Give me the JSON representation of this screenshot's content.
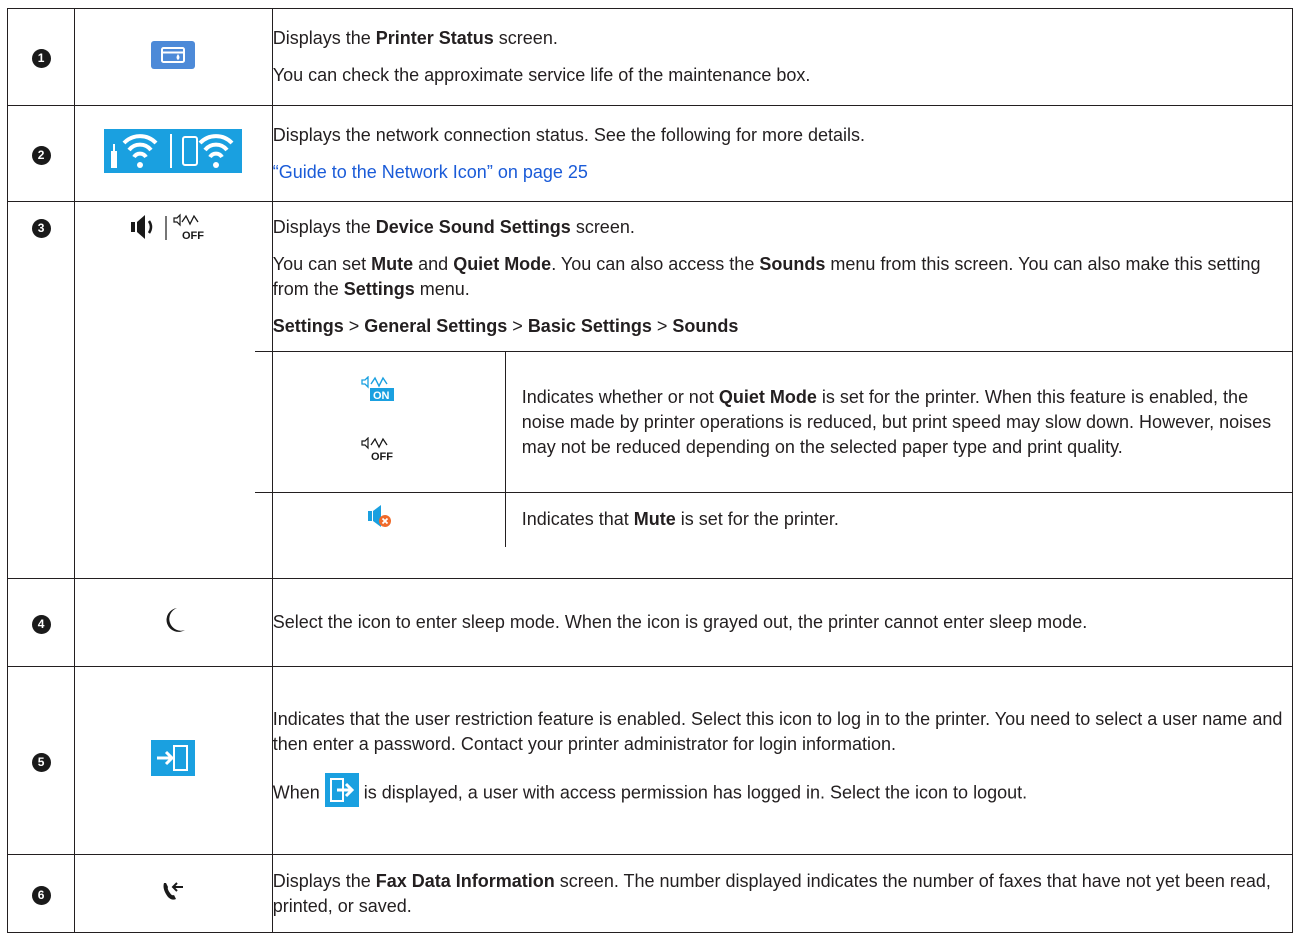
{
  "rows": [
    {
      "num": "1",
      "icon": "printer-status-icon",
      "lines": [
        [
          "Displays the ",
          "Printer Status",
          " screen."
        ],
        "You can check the approximate service life of the maintenance box."
      ]
    },
    {
      "num": "2",
      "icon": "network-status-icons",
      "text": "Displays the network connection status. See the following for more details.",
      "link": "“Guide to the Network Icon” on page 25"
    },
    {
      "num": "3",
      "icon": "sound-icons",
      "p1": {
        "a": "Displays the ",
        "b": "Device Sound Settings",
        "c": " screen."
      },
      "p2": {
        "t1": "You can set ",
        "b1": "Mute",
        "t2": " and ",
        "b2": "Quiet Mode",
        "t3": ". You can also access the ",
        "b3": "Sounds",
        "t4": " menu from this screen. You can also make this setting from the ",
        "b4": "Settings",
        "t5": " menu."
      },
      "path": [
        "Settings",
        "General Settings",
        "Basic Settings",
        "Sounds"
      ],
      "path_sep": " > ",
      "sub": [
        {
          "icon_top": "quiet-mode-on-icon",
          "icon_bottom": "quiet-mode-off-icon",
          "t1": "Indicates whether or not ",
          "b1": "Quiet Mode",
          "t2": " is set for the printer. When this feature is enabled, the noise made by printer operations is reduced, but print speed may slow down. However, noises may not be reduced depending on the selected paper type and print quality."
        },
        {
          "icon": "mute-icon",
          "t1": "Indicates that ",
          "b1": "Mute",
          "t2": " is set for the printer."
        }
      ]
    },
    {
      "num": "4",
      "icon": "sleep-moon-icon",
      "text": "Select the icon to enter sleep mode. When the icon is grayed out, the printer cannot enter sleep mode."
    },
    {
      "num": "5",
      "icon": "login-icon",
      "text": "Indicates that the user restriction feature is enabled. Select this icon to log in to the printer. You need to select a user name and then enter a password. Contact your printer administrator for login information.",
      "p2_a": "When ",
      "p2_icon": "logout-icon",
      "p2_b": " is displayed, a user with access permission has logged in. Select the icon to logout."
    },
    {
      "num": "6",
      "icon": "fax-data-icon",
      "t1": "Displays the ",
      "b1": "Fax Data Information",
      "t2": " screen. The number displayed indicates the number of faxes that have not yet been read, printed, or saved."
    }
  ],
  "icon_texts": {
    "on": "ON",
    "off": "OFF"
  },
  "colors": {
    "icon_blue": "#4d8ad8",
    "link": "#1a5bd8",
    "accent_cyan": "#1aa0e0",
    "mute_orange": "#f06a2a"
  }
}
